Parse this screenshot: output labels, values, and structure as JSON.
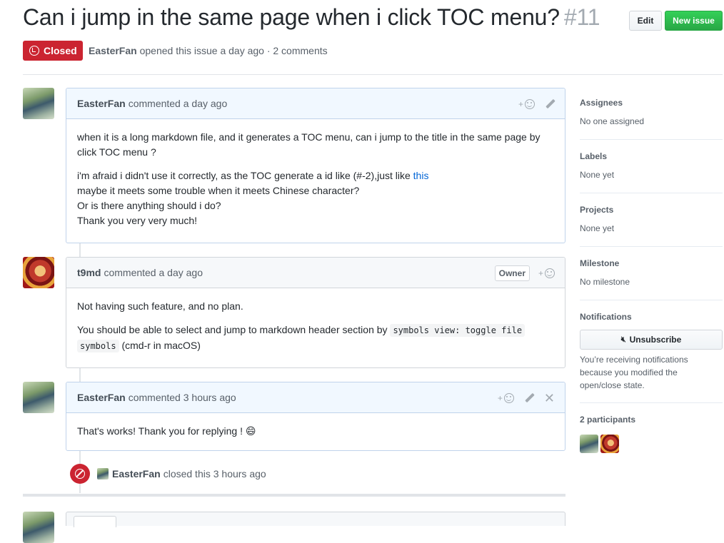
{
  "issue": {
    "title": "Can i jump in the same page when i click TOC menu?",
    "number": "#11",
    "state": "Closed",
    "author": "EasterFan",
    "meta_text": "opened this issue a day ago · 2 comments"
  },
  "buttons": {
    "edit": "Edit",
    "new_issue": "New issue"
  },
  "comments": [
    {
      "author": "EasterFan",
      "time_text": "commented a day ago",
      "paragraphs": [
        "when it is a long markdown file, and it generates a TOC menu, can i jump to the title in the same page by click TOC menu ?"
      ],
      "p2_line1": "i'm afraid i didn't use it correctly, as the TOC generate a id like (#-2),just like ",
      "p2_link": "this",
      "p2_line2": "maybe it meets some trouble when it meets Chinese character?",
      "p2_line3": "Or is there anything should i do?",
      "p2_line4": "Thank you very very much!"
    },
    {
      "author": "t9md",
      "time_text": "commented a day ago",
      "badge": "Owner",
      "p1": "Not having such feature, and no plan.",
      "p2_before": "You should be able to select and jump to markdown header section by ",
      "p2_code1": "symbols view: toggle file",
      "p2_code2": "symbols",
      "p2_after": " (cmd-r in macOS)"
    },
    {
      "author": "EasterFan",
      "time_text": "commented 3 hours ago",
      "text": "That's works! Thank you for replying ! 😄"
    }
  ],
  "event": {
    "actor": "EasterFan",
    "text": "closed this 3 hours ago"
  },
  "sidebar": {
    "assignees": {
      "title": "Assignees",
      "value": "No one assigned"
    },
    "labels": {
      "title": "Labels",
      "value": "None yet"
    },
    "projects": {
      "title": "Projects",
      "value": "None yet"
    },
    "milestone": {
      "title": "Milestone",
      "value": "No milestone"
    },
    "notifications": {
      "title": "Notifications",
      "button": "Unsubscribe",
      "note": "You’re receiving notifications because you modified the open/close state."
    },
    "participants": {
      "title": "2 participants"
    }
  },
  "colors": {
    "closed": "#cb2431",
    "link": "#0366d6",
    "new_issue": "#28a745"
  },
  "icons": [
    "issue-closed-icon",
    "smiley-icon",
    "pencil-icon",
    "x-icon",
    "circle-slash-icon",
    "mute-icon"
  ]
}
